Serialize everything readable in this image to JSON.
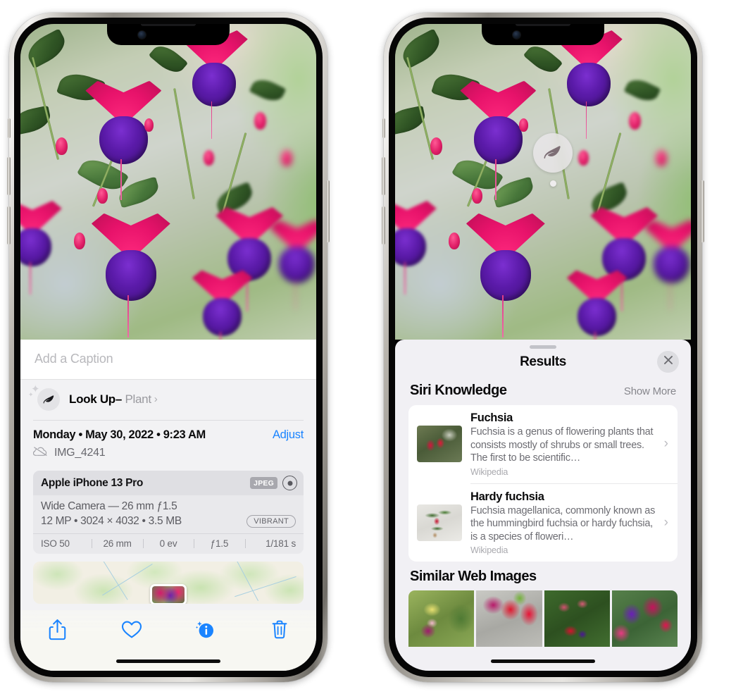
{
  "left_phone": {
    "caption_placeholder": "Add a Caption",
    "lookup": {
      "label": "Look Up",
      "dash": "–",
      "subject": "Plant",
      "chevron": "›",
      "icon": "leaf-icon"
    },
    "date_text": "Monday • May 30, 2022 • 9:23 AM",
    "adjust_label": "Adjust",
    "file_name": "IMG_4241",
    "cloud_icon": "cloud-slash-icon",
    "exif": {
      "device": "Apple iPhone 13 Pro",
      "format_chip": "JPEG",
      "lens_icon": "aperture-icon",
      "lens_line": "Wide Camera — 26 mm ƒ1.5",
      "size_line": "12 MP • 3024 × 4032 • 3.5 MB",
      "vibrant_chip": "VIBRANT",
      "stats": [
        "ISO 50",
        "26 mm",
        "0 ev",
        "ƒ1.5",
        "1/181 s"
      ]
    },
    "toolbar": [
      {
        "name": "share-button",
        "icon": "share-icon"
      },
      {
        "name": "favorite-button",
        "icon": "heart-icon"
      },
      {
        "name": "info-button",
        "icon": "info-sparkle-icon"
      },
      {
        "name": "delete-button",
        "icon": "trash-icon"
      }
    ],
    "accent_color": "#1a84ff"
  },
  "right_phone": {
    "visual_lookup_badge": {
      "icon": "leaf-icon",
      "name": "visual-lookup-badge"
    },
    "sheet": {
      "title": "Results",
      "close_icon": "close-icon",
      "sections": [
        {
          "title": "Siri Knowledge",
          "action": "Show More",
          "items": [
            {
              "title": "Fuchsia",
              "description": "Fuchsia is a genus of flowering plants that consists mostly of shrubs or small trees. The first to be scientific…",
              "source": "Wikipedia",
              "chevron": "›"
            },
            {
              "title": "Hardy fuchsia",
              "description": "Fuchsia magellanica, commonly known as the hummingbird fuchsia or hardy fuchsia, is a species of floweri…",
              "source": "Wikipedia",
              "chevron": "›"
            }
          ]
        },
        {
          "title": "Similar Web Images",
          "thumbnails": [
            "fuchsia-magenta-white-bloom",
            "fuchsia-red-pink-closeup",
            "fuchsia-bush-red-buds",
            "fuchsia-purple-magenta-cluster"
          ]
        }
      ]
    }
  }
}
